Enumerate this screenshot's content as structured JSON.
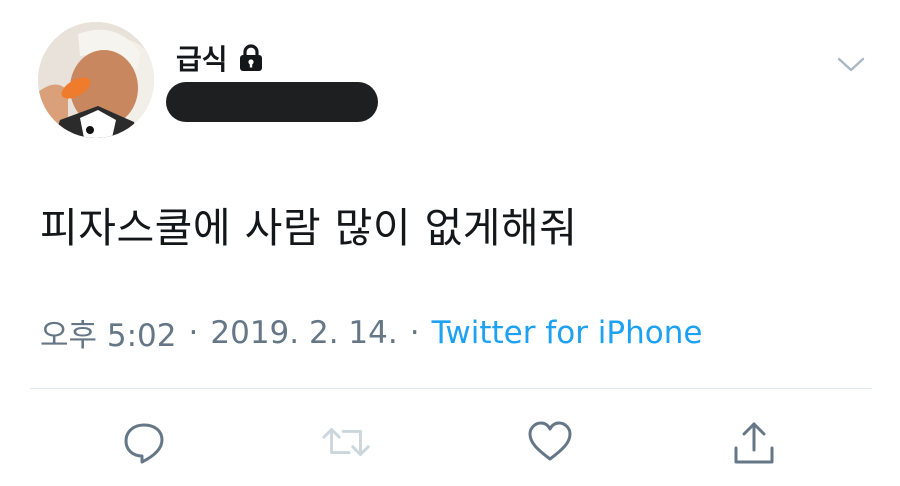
{
  "user": {
    "display_name": "급식",
    "protected_icon": "lock-icon",
    "handle_state": "redacted"
  },
  "tweet": {
    "text": "피자스쿨에 사람 많이 없게해줘"
  },
  "meta": {
    "time": "오후 5:02",
    "separator": "·",
    "date": "2019. 2. 14.",
    "source": "Twitter for iPhone"
  },
  "actions": {
    "reply": "reply-icon",
    "retweet": "retweet-icon",
    "retweet_state": "disabled",
    "like": "heart-icon",
    "share": "share-icon"
  },
  "menu": {
    "icon": "chevron-down-icon"
  },
  "colors": {
    "text": "#14171a",
    "secondary": "#657786",
    "link": "#1da1f2",
    "divider": "#e1e8ed",
    "disabled": "#ccd6dd"
  }
}
